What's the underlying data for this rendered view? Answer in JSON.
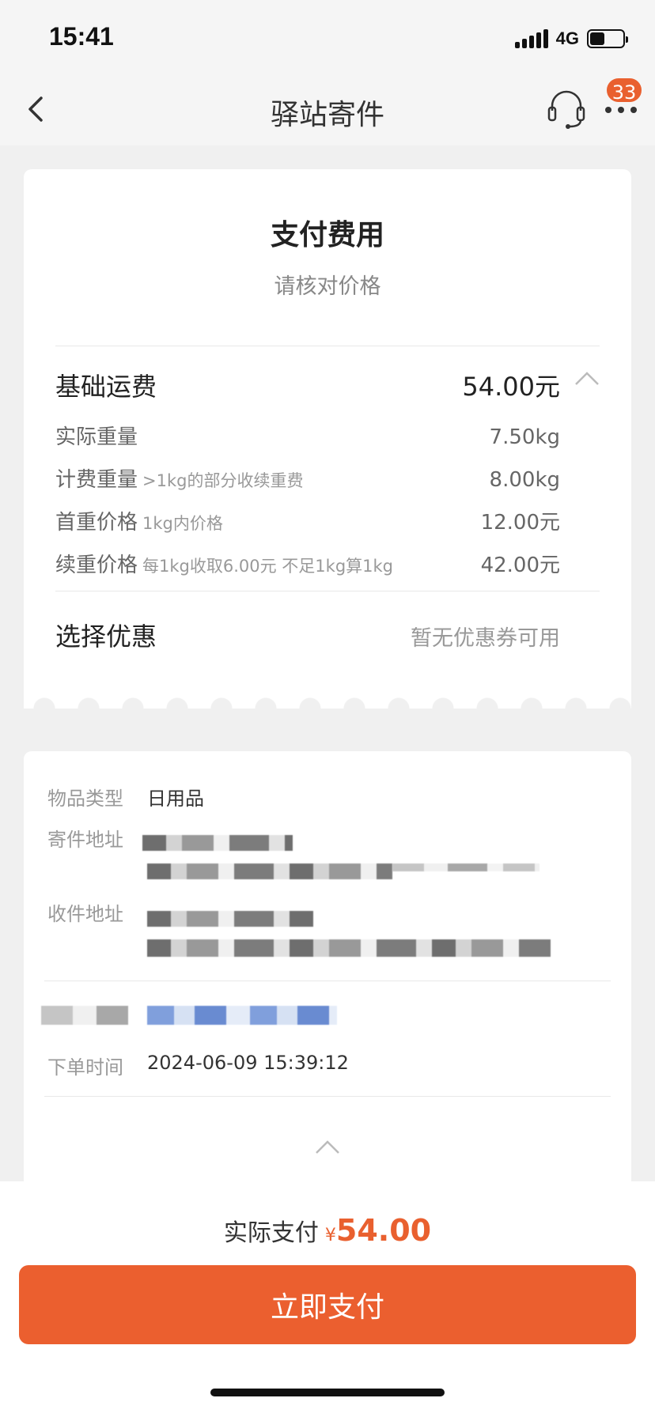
{
  "status_bar": {
    "time": "15:41",
    "network": "4G",
    "battery_level": 0.45
  },
  "nav": {
    "title": "驿站寄件",
    "badge_count": "33"
  },
  "fee_card": {
    "title": "支付费用",
    "subtitle": "请核对价格",
    "base_fee_label": "基础运费",
    "base_fee_value": "54.00元",
    "rows": [
      {
        "label": "实际重量",
        "note": "",
        "value": "7.50kg"
      },
      {
        "label": "计费重量",
        "note": ">1kg的部分收续重费",
        "value": "8.00kg"
      },
      {
        "label": "首重价格",
        "note": "1kg内价格",
        "value": "12.00元"
      },
      {
        "label": "续重价格",
        "note": "每1kg收取6.00元 不足1kg算1kg",
        "value": "42.00元"
      }
    ],
    "coupon_label": "选择优惠",
    "coupon_value": "暂无优惠券可用"
  },
  "order_card": {
    "item_type_label": "物品类型",
    "item_type_value": "日用品",
    "sender_label": "寄件地址",
    "receiver_label": "收件地址",
    "order_time_label": "下单时间",
    "order_time_value": "2024-06-09 15:39:12"
  },
  "pay_bar": {
    "label": "实际支付",
    "currency": "¥",
    "amount": "54.00",
    "button_label": "立即支付"
  }
}
